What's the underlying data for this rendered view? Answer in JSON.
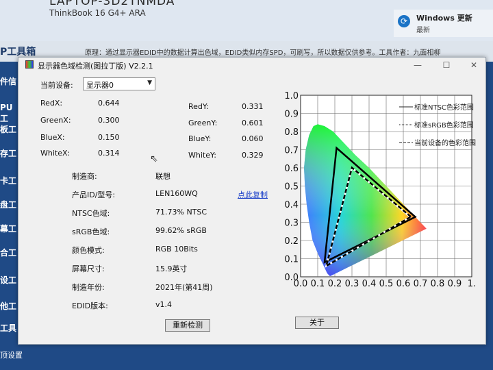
{
  "background": {
    "hostname": "LAPTOP-3D2TNMDA",
    "model": "ThinkBook 16 G4+ ARA",
    "windows_update": {
      "title": "Windows 更新",
      "subtitle": "最新"
    },
    "app_title_frag": "P工具箱",
    "description": "原理：通过显示器EDID中的数据计算出色域，EDID类似内存SPD，可刷写，所以数据仅供参考。工具作者：九面相柳",
    "sidebar": [
      "件信",
      "PU工",
      "板工",
      "存工",
      "卡工",
      "盘工",
      "幕工",
      "合工",
      "设工",
      "他工",
      "工具"
    ],
    "bottom_item": "顶设置"
  },
  "window": {
    "title": "显示器色域检测(图拉丁版) V2.2.1",
    "controls": {
      "minimize": "—",
      "maximize": "☐",
      "close": "✕"
    },
    "device_label": "当前设备:",
    "device_value": "显示器0",
    "chromaticity": {
      "red_x": {
        "label": "RedX:",
        "value": "0.644"
      },
      "green_x": {
        "label": "GreenX:",
        "value": "0.300"
      },
      "blue_x": {
        "label": "BlueX:",
        "value": "0.150"
      },
      "white_x": {
        "label": "WhiteX:",
        "value": "0.314"
      },
      "red_y": {
        "label": "RedY:",
        "value": "0.331"
      },
      "green_y": {
        "label": "GreenY:",
        "value": "0.601"
      },
      "blue_y": {
        "label": "BlueY:",
        "value": "0.060"
      },
      "white_y": {
        "label": "WhiteY:",
        "value": "0.329"
      }
    },
    "info": [
      {
        "label": "制造商:",
        "value": "联想"
      },
      {
        "label": "产品ID/型号:",
        "value": "LEN160WQ",
        "link": "点此复制"
      },
      {
        "label": "NTSC色域:",
        "value": "71.73% NTSC"
      },
      {
        "label": "sRGB色域:",
        "value": "99.62% sRGB"
      },
      {
        "label": "颜色模式:",
        "value": "RGB 10Bits"
      },
      {
        "label": "屏幕尺寸:",
        "value": "15.9英寸"
      },
      {
        "label": "制造年份:",
        "value": "2021年(第41周)"
      },
      {
        "label": "EDID版本:",
        "value": "v1.4"
      }
    ],
    "buttons": {
      "redetect": "重新检测",
      "about": "关于"
    }
  },
  "chart_data": {
    "type": "scatter",
    "title": "",
    "xlim": [
      0,
      1.0
    ],
    "ylim": [
      0,
      1.0
    ],
    "x_ticks": [
      "0.0",
      "0.1",
      "0.2",
      "0.3",
      "0.4",
      "0.5",
      "0.6",
      "0.7",
      "0.8",
      "0.9",
      "1."
    ],
    "y_ticks": [
      "1.0",
      "0.9",
      "0.8",
      "0.7",
      "0.6",
      "0.5",
      "0.4",
      "0.3",
      "0.2",
      "0.1",
      "0.0"
    ],
    "grid": true,
    "legend_position": "top-right",
    "series": [
      {
        "name": "标准NTSC色彩范围",
        "style": "solid",
        "color": "#000000",
        "points": [
          [
            0.67,
            0.33
          ],
          [
            0.21,
            0.71
          ],
          [
            0.14,
            0.08
          ]
        ]
      },
      {
        "name": "标准sRGB色彩范围",
        "style": "dotted",
        "color": "#ffffff",
        "points": [
          [
            0.64,
            0.33
          ],
          [
            0.3,
            0.6
          ],
          [
            0.15,
            0.06
          ]
        ]
      },
      {
        "name": "当前设备的色彩范围",
        "style": "dashed",
        "color": "#000000",
        "points": [
          [
            0.644,
            0.331
          ],
          [
            0.3,
            0.601
          ],
          [
            0.15,
            0.06
          ]
        ]
      }
    ]
  }
}
